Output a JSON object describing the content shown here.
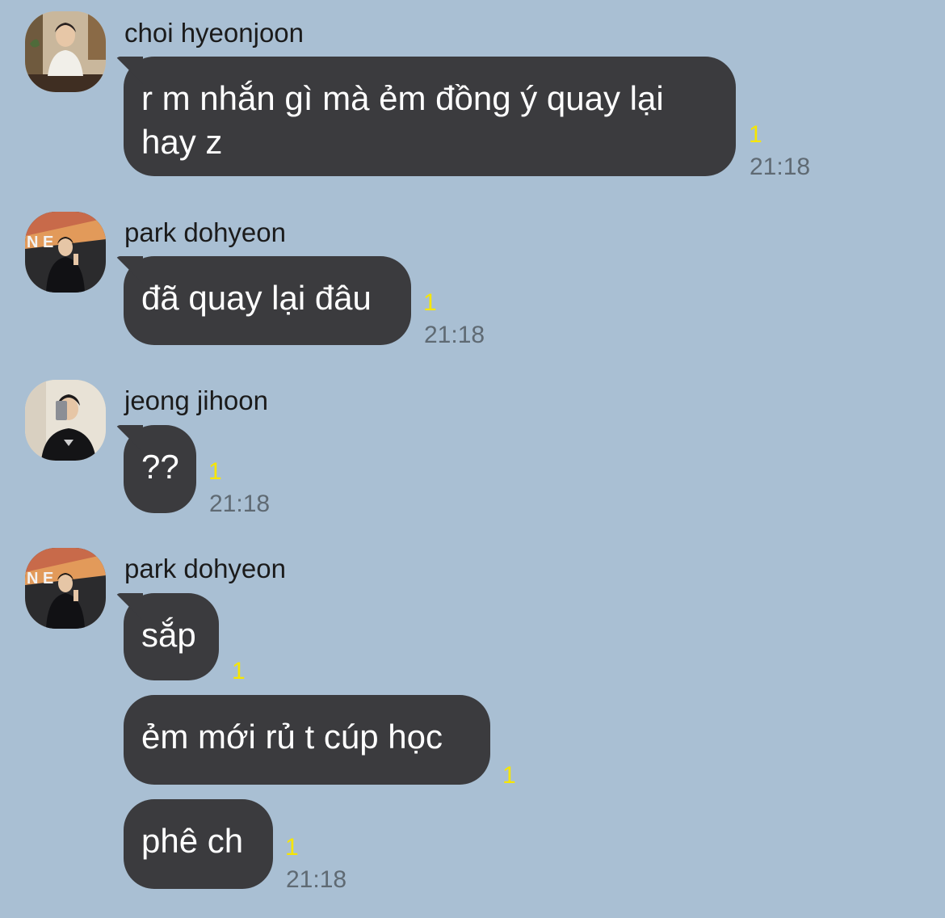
{
  "colors": {
    "background": "#a9bfd3",
    "bubble": "#3b3b3e",
    "bubble_text": "#ffffff",
    "unread": "#f7e600",
    "time": "#5f6a73"
  },
  "messages": [
    {
      "sender": "choi hyeonjoon",
      "avatar": "profile-photo",
      "bubbles": [
        {
          "text": "r m nhắn gì mà ẻm đồng ý quay lại hay z",
          "unread": "1",
          "time": "21:18"
        }
      ]
    },
    {
      "sender": "park dohyeon",
      "avatar": "profile-photo",
      "bubbles": [
        {
          "text": "đã quay lại đâu",
          "unread": "1",
          "time": "21:18"
        }
      ]
    },
    {
      "sender": "jeong jihoon",
      "avatar": "profile-photo",
      "bubbles": [
        {
          "text": "??",
          "unread": "1",
          "time": "21:18"
        }
      ]
    },
    {
      "sender": "park dohyeon",
      "avatar": "profile-photo",
      "bubbles": [
        {
          "text": "sắp",
          "unread": "1",
          "time": ""
        },
        {
          "text": "ẻm mới rủ t cúp học",
          "unread": "1",
          "time": ""
        },
        {
          "text": "phê ch",
          "unread": "1",
          "time": "21:18"
        }
      ]
    }
  ]
}
